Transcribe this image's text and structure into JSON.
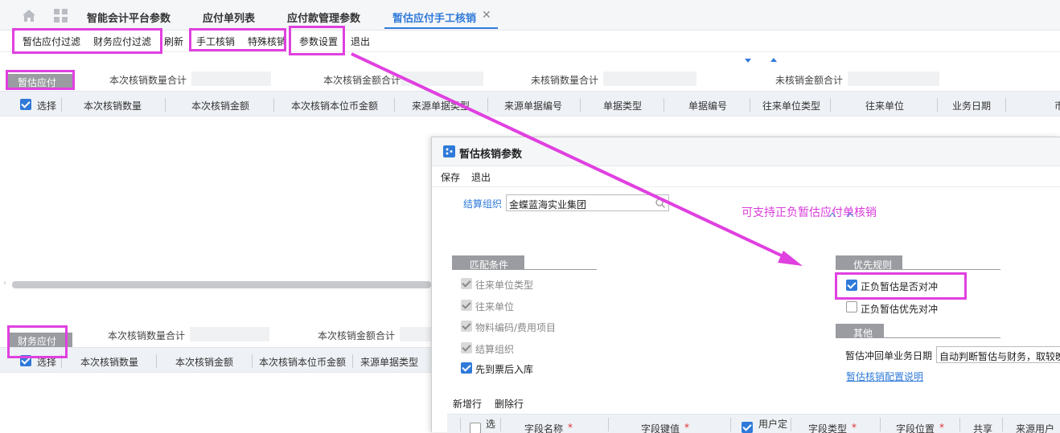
{
  "tabs": {
    "home_icon": "home-icon",
    "grid_icon": "grid-icon",
    "items": [
      "智能会计平台参数",
      "应付单列表",
      "应付款管理参数",
      "暂估应付手工核销"
    ],
    "close_glyph": "✕"
  },
  "toolbar": {
    "items": [
      "暂估应付过滤",
      "财务应付过滤",
      "刷新",
      "手工核销",
      "特殊核销",
      "参数设置",
      "退出"
    ]
  },
  "top_section": {
    "tag": "暂估应付",
    "summary": [
      "本次核销数量合计",
      "本次核销金额合计",
      "未核销数量合计",
      "未核销金额合计"
    ],
    "columns": [
      "选择",
      "本次核销数量",
      "本次核销金额",
      "本次核销本位币金额",
      "来源单据类型",
      "来源单据编号",
      "单据类型",
      "单据编号",
      "往来单位类型",
      "往来单位",
      "业务日期",
      "币"
    ]
  },
  "bottom_section": {
    "tag": "财务应付",
    "summary": [
      "本次核销数量合计",
      "本次核销金额合计"
    ],
    "columns": [
      "选择",
      "本次核销数量",
      "本次核销金额",
      "本次核销本位币金额",
      "来源单据类型"
    ]
  },
  "dialog": {
    "title": "暂估核销参数",
    "actions": [
      "保存",
      "退出"
    ],
    "org_label": "结算组织",
    "org_value": "金蝶蓝海实业集团",
    "match_title": "匹配条件",
    "match_items": [
      "往来单位类型",
      "往来单位",
      "物料编码/费用项目",
      "结算组织",
      "先到票后入库"
    ],
    "priority_title": "优先规则",
    "priority_items": [
      "正负暂估是否对冲",
      "正负暂估优先对冲"
    ],
    "other_title": "其他",
    "date_label": "暂估冲回单业务日期",
    "date_value": "自动判断暂估与财务，取较晚",
    "help_link": "暂估核销配置说明",
    "row_actions": [
      "新增行",
      "删除行"
    ],
    "columns": [
      "选",
      "字段名称",
      "字段键值",
      "用户定",
      "字段类型",
      "字段位置",
      "共享",
      "来源用户"
    ],
    "required_mark": "*"
  },
  "annotation": "可支持正负暂估应付单核销",
  "colors": {
    "accent": "#2f7ad9",
    "highlight": "#e040e0",
    "annotation": "#d93bd9"
  }
}
